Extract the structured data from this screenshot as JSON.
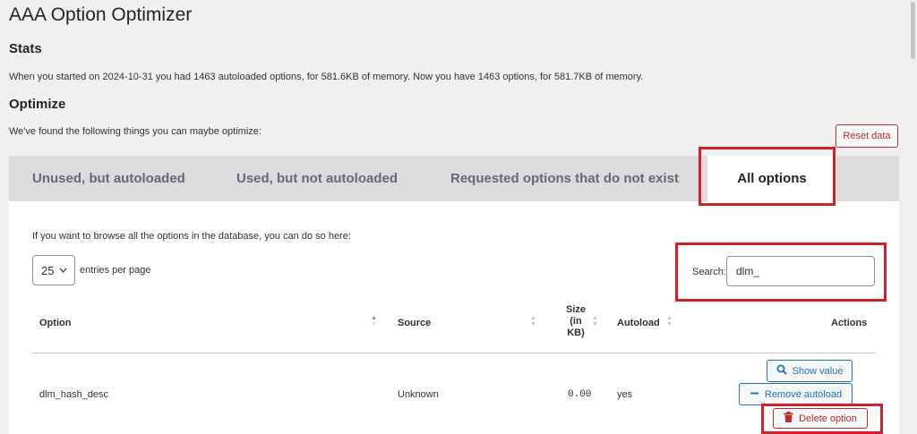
{
  "page": {
    "title": "AAA Option Optimizer",
    "stats_heading": "Stats",
    "stats_text": "When you started on 2024-10-31 you had 1463 autoloaded options, for 581.6KB of memory. Now you have 1463 options, for 581.7KB of memory.",
    "optimize_heading": "Optimize",
    "found_text": "We've found the following things you can maybe optimize:",
    "reset_label": "Reset data"
  },
  "tabs": [
    {
      "label": "Unused, but autoloaded"
    },
    {
      "label": "Used, but not autoloaded"
    },
    {
      "label": "Requested options that do not exist"
    },
    {
      "label": "All options",
      "active": true
    }
  ],
  "panel": {
    "browse_text": "If you want to browse all the options in the database, you can do so here:",
    "entries_value": "25",
    "entries_label": "entries per page",
    "search_label": "Search:",
    "search_value": "dlm_"
  },
  "table": {
    "headers": {
      "option": "Option",
      "source": "Source",
      "size_line1": "Size",
      "size_line2": "(in",
      "size_line3": "KB)",
      "autoload": "Autoload",
      "actions": "Actions"
    },
    "rows": [
      {
        "option": "dlm_hash_desc",
        "source": "Unknown",
        "size": "0.00",
        "autoload": "yes",
        "actions": {
          "show": "Show value",
          "remove": "Remove autoload",
          "delete": "Delete option"
        }
      }
    ]
  },
  "colors": {
    "highlight": "#d0202a",
    "primary": "#2271b1",
    "danger": "#b32d2e"
  },
  "icons": {
    "search": "search-icon",
    "minus": "minus-icon",
    "trash": "trash-icon",
    "chevron": "chevron-down-icon",
    "sort": "sort-arrows-icon"
  }
}
